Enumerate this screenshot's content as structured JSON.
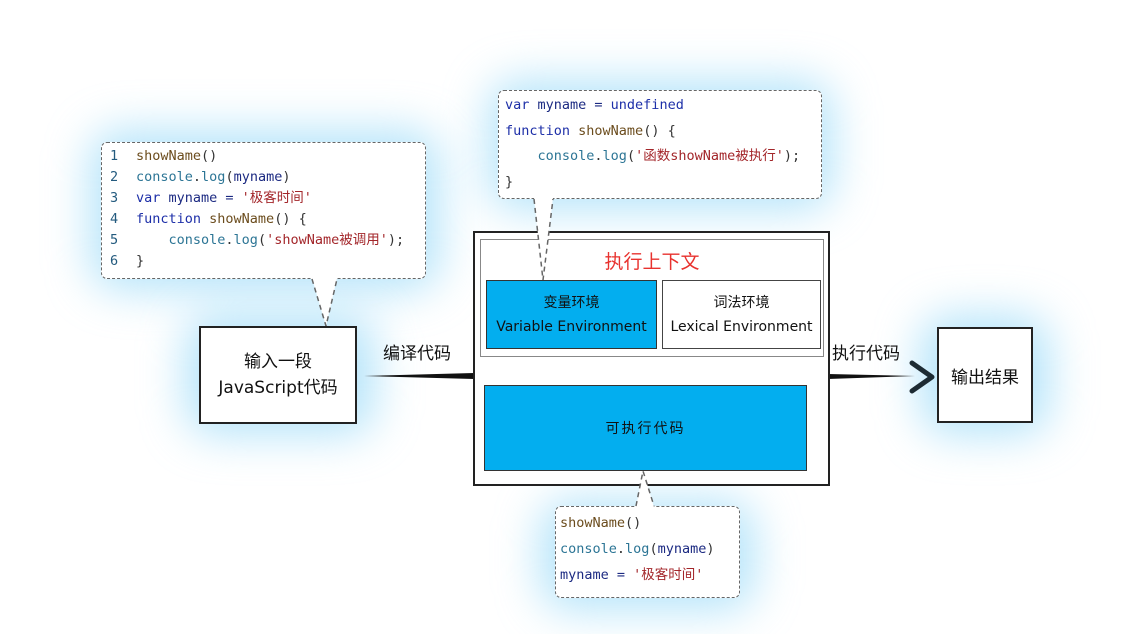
{
  "source_code": {
    "lines": [
      {
        "num": "1",
        "parts": [
          {
            "t": "showName",
            "c": "fn"
          },
          {
            "t": "()",
            "c": "pn"
          }
        ]
      },
      {
        "num": "2",
        "parts": [
          {
            "t": "console",
            "c": "obj"
          },
          {
            "t": ".",
            "c": "pn"
          },
          {
            "t": "log",
            "c": "obj"
          },
          {
            "t": "(",
            "c": "pn"
          },
          {
            "t": "myname",
            "c": "var"
          },
          {
            "t": ")",
            "c": "pn"
          }
        ]
      },
      {
        "num": "3",
        "parts": [
          {
            "t": "var",
            "c": "kw"
          },
          {
            "t": " myname = ",
            "c": "var"
          },
          {
            "t": "'极客时间'",
            "c": "str"
          }
        ]
      },
      {
        "num": "4",
        "parts": [
          {
            "t": "function",
            "c": "kw"
          },
          {
            "t": " showName",
            "c": "fn"
          },
          {
            "t": "() {",
            "c": "pn"
          }
        ]
      },
      {
        "num": "5",
        "parts": [
          {
            "t": "    console",
            "c": "obj"
          },
          {
            "t": ".",
            "c": "pn"
          },
          {
            "t": "log",
            "c": "obj"
          },
          {
            "t": "(",
            "c": "pn"
          },
          {
            "t": "'showName被调用'",
            "c": "str"
          },
          {
            "t": ");",
            "c": "pn"
          }
        ]
      },
      {
        "num": "6",
        "parts": [
          {
            "t": "}",
            "c": "pn"
          }
        ]
      }
    ]
  },
  "variable_env_code": {
    "lines": [
      {
        "parts": [
          {
            "t": "var",
            "c": "kw"
          },
          {
            "t": " myname = ",
            "c": "var"
          },
          {
            "t": "undefined",
            "c": "kw"
          }
        ]
      },
      {
        "parts": [
          {
            "t": "function",
            "c": "kw"
          },
          {
            "t": " showName",
            "c": "fn"
          },
          {
            "t": "() {",
            "c": "pn"
          }
        ]
      },
      {
        "parts": [
          {
            "t": "    console",
            "c": "obj"
          },
          {
            "t": ".",
            "c": "pn"
          },
          {
            "t": "log",
            "c": "obj"
          },
          {
            "t": "(",
            "c": "pn"
          },
          {
            "t": "'函数showName被执行'",
            "c": "str"
          },
          {
            "t": ");",
            "c": "pn"
          }
        ]
      },
      {
        "parts": [
          {
            "t": "}",
            "c": "pn"
          }
        ]
      }
    ]
  },
  "executable_code": {
    "lines": [
      {
        "parts": [
          {
            "t": "showName",
            "c": "fn"
          },
          {
            "t": "()",
            "c": "pn"
          }
        ]
      },
      {
        "parts": [
          {
            "t": "console",
            "c": "obj"
          },
          {
            "t": ".",
            "c": "pn"
          },
          {
            "t": "log",
            "c": "obj"
          },
          {
            "t": "(",
            "c": "pn"
          },
          {
            "t": "myname",
            "c": "var"
          },
          {
            "t": ")",
            "c": "pn"
          }
        ]
      },
      {
        "parts": [
          {
            "t": "myname = ",
            "c": "var"
          },
          {
            "t": "'极客时间'",
            "c": "str"
          }
        ]
      }
    ]
  },
  "input_box": {
    "line1": "输入一段",
    "line2": "JavaScript代码"
  },
  "compile_label": "编译代码",
  "execute_label": "执行代码",
  "output_box": "输出结果",
  "execution_context": {
    "title": "执行上下文",
    "variable_environment": {
      "cn": "变量环境",
      "en": "Variable Environment"
    },
    "lexical_environment": {
      "cn": "词法环境",
      "en": "Lexical Environment"
    },
    "executable_code_label": "可执行代码"
  },
  "colors": {
    "accent_blue": "#03aeef",
    "title_red": "#e8322e",
    "glow": "#78cdf5"
  }
}
